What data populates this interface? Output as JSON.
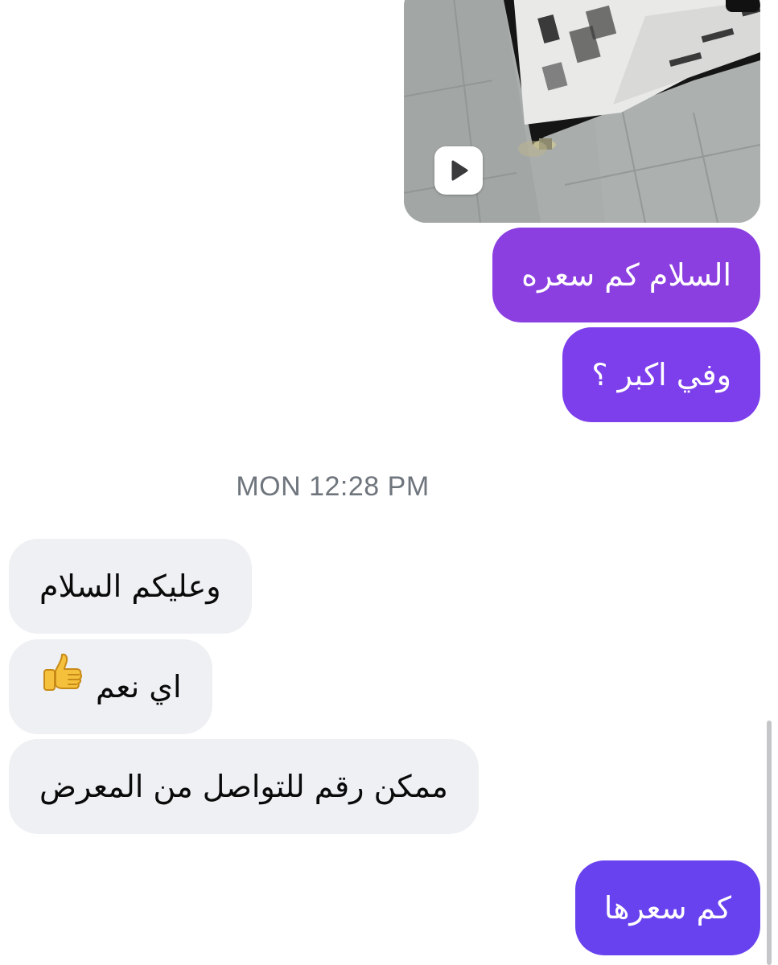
{
  "thread": {
    "video_message": {
      "play_icon": "play-icon"
    },
    "outgoing_1": {
      "text": "السلام كم سعره",
      "color": "#8b3fe0"
    },
    "outgoing_2": {
      "text": "وفي اكبر ؟",
      "color": "#7d3eec"
    },
    "timestamp": "MON 12:28 PM",
    "incoming_1": {
      "text": "وعليكم السلام"
    },
    "incoming_2": {
      "text": "اي نعم",
      "emoji": "thumbs-up-icon"
    },
    "incoming_3": {
      "text": "ممكن رقم للتواصل من المعرض"
    },
    "outgoing_3": {
      "text": "كم سعرها",
      "color": "#6842ef"
    }
  },
  "colors": {
    "incoming_bubble": "#eef0f3",
    "timestamp_text": "#6f757d"
  }
}
